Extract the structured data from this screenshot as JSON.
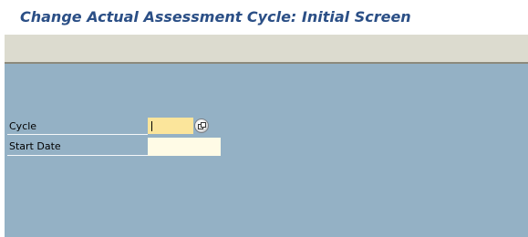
{
  "window": {
    "title": "Change Actual Assessment Cycle: Initial Screen"
  },
  "form": {
    "cycle": {
      "label": "Cycle",
      "value": "",
      "value_help_icon": "value-help-icon"
    },
    "start_date": {
      "label": "Start Date",
      "value": ""
    }
  },
  "colors": {
    "title": "#2b4f86",
    "toolbar": "#dcdbcf",
    "background": "#94b1c5",
    "required_field": "#fbe59b",
    "optional_field": "#fffbe6"
  }
}
